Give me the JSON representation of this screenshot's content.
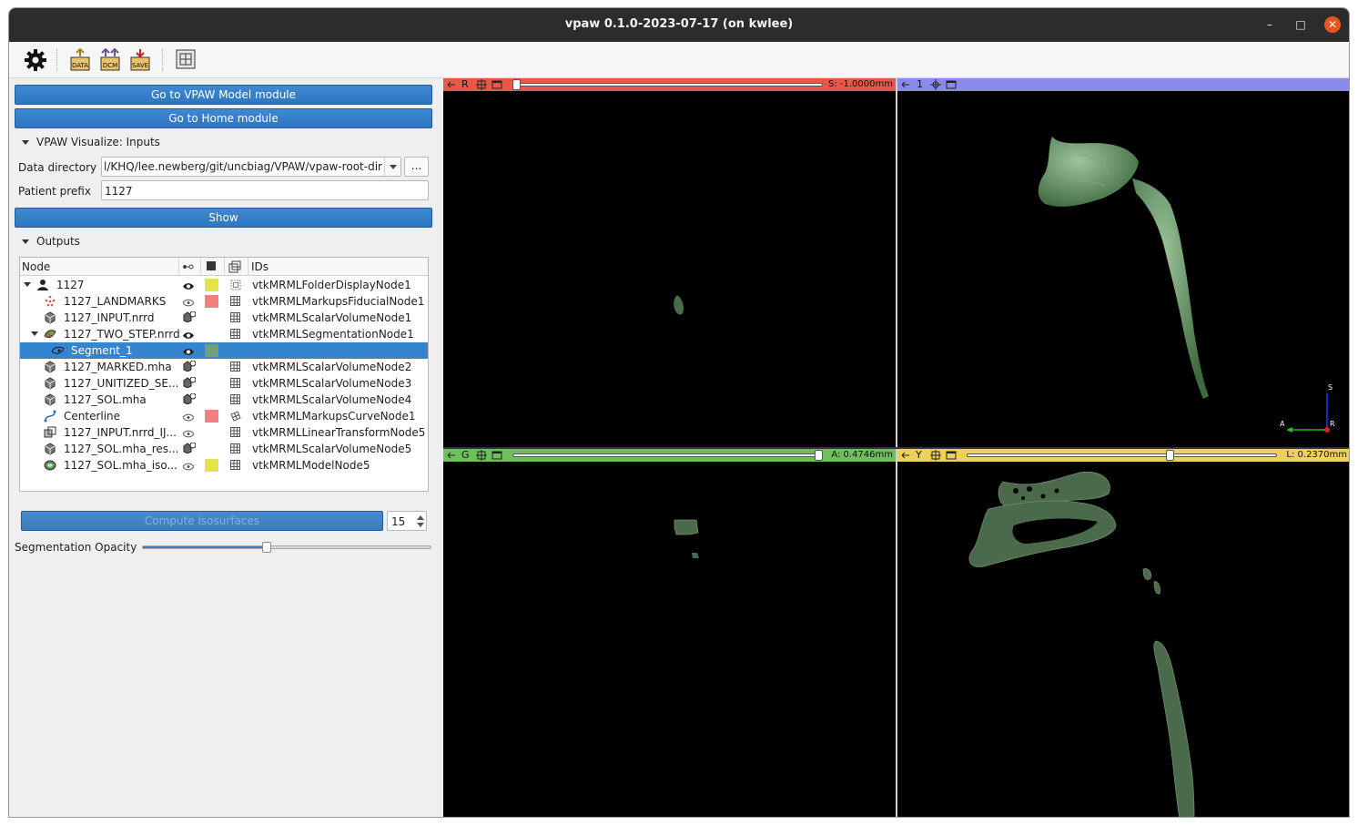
{
  "window": {
    "title": "vpaw 0.1.0-2023-07-17 (on kwlee)",
    "minimize": "–",
    "maximize": "□",
    "close": "✕"
  },
  "toolbar": {
    "icons": [
      "gear-icon",
      "data-icon",
      "dcm-icon",
      "save-icon",
      "layout-icon"
    ],
    "data_label": "DATA",
    "dcm_label": "DCM",
    "save_label": "SAVE"
  },
  "panel": {
    "goto_model": "Go to VPAW Model module",
    "goto_home": "Go to Home module",
    "inputs_section": "VPAW Visualize: Inputs",
    "data_directory_label": "Data directory",
    "data_directory_value": "l/KHQ/lee.newberg/git/uncbiag/VPAW/vpaw-root-dir",
    "browse_label": "...",
    "patient_prefix_label": "Patient prefix",
    "patient_prefix_value": "1127",
    "show_button": "Show",
    "outputs_section": "Outputs",
    "compute_button": "Compute Isosurfaces",
    "iso_value": "15",
    "opacity_label": "Segmentation Opacity",
    "opacity_fraction": 0.43
  },
  "tree": {
    "headers": {
      "node": "Node",
      "ids": "IDs"
    },
    "rows": [
      {
        "name": "1127",
        "id": "vtkMRMLFolderDisplayNode1",
        "icon": "patient-icon",
        "color": "#e3e34a"
      },
      {
        "name": "1127_LANDMARKS",
        "id": "vtkMRMLMarkupsFiducialNode1",
        "icon": "landmarks-icon",
        "color": "#f08080"
      },
      {
        "name": "1127_INPUT.nrrd",
        "id": "vtkMRMLScalarVolumeNode1",
        "icon": "volume-icon",
        "color": ""
      },
      {
        "name": "1127_TWO_STEP.nrrd",
        "id": "vtkMRMLSegmentationNode1",
        "icon": "segmentation-icon",
        "color": ""
      },
      {
        "name": "Segment_1",
        "id": "",
        "icon": "segment-icon",
        "color": "#6f9f7f"
      },
      {
        "name": "1127_MARKED.mha",
        "id": "vtkMRMLScalarVolumeNode2",
        "icon": "volume-icon",
        "color": ""
      },
      {
        "name": "1127_UNITIZED_SE...",
        "id": "vtkMRMLScalarVolumeNode3",
        "icon": "volume-icon",
        "color": ""
      },
      {
        "name": "1127_SOL.mha",
        "id": "vtkMRMLScalarVolumeNode4",
        "icon": "volume-icon",
        "color": ""
      },
      {
        "name": "Centerline",
        "id": "vtkMRMLMarkupsCurveNode1",
        "icon": "curve-icon",
        "color": "#f08080"
      },
      {
        "name": "1127_INPUT.nrrd_IJ...",
        "id": "vtkMRMLLinearTransformNode5",
        "icon": "transform-icon",
        "color": ""
      },
      {
        "name": "1127_SOL.mha_res...",
        "id": "vtkMRMLScalarVolumeNode5",
        "icon": "volume-icon",
        "color": ""
      },
      {
        "name": "1127_SOL.mha_iso...",
        "id": "vtkMRMLModelNode5",
        "icon": "model-icon",
        "color": "#e3e34a"
      }
    ]
  },
  "views": {
    "red": {
      "label": "R",
      "value": "S: -1.0000mm",
      "color": "#e8584a",
      "slider": 0.0
    },
    "threeD": {
      "label": "1",
      "color": "#8a8aeb"
    },
    "green": {
      "label": "G",
      "value": "A: 0.4746mm",
      "color": "#6ec05a",
      "slider": 1.0
    },
    "yellow": {
      "label": "Y",
      "value": "L: 0.2370mm",
      "color": "#eed05a",
      "slider": 0.66
    },
    "orientation": {
      "s": "S",
      "a": "A",
      "r": "R"
    }
  }
}
